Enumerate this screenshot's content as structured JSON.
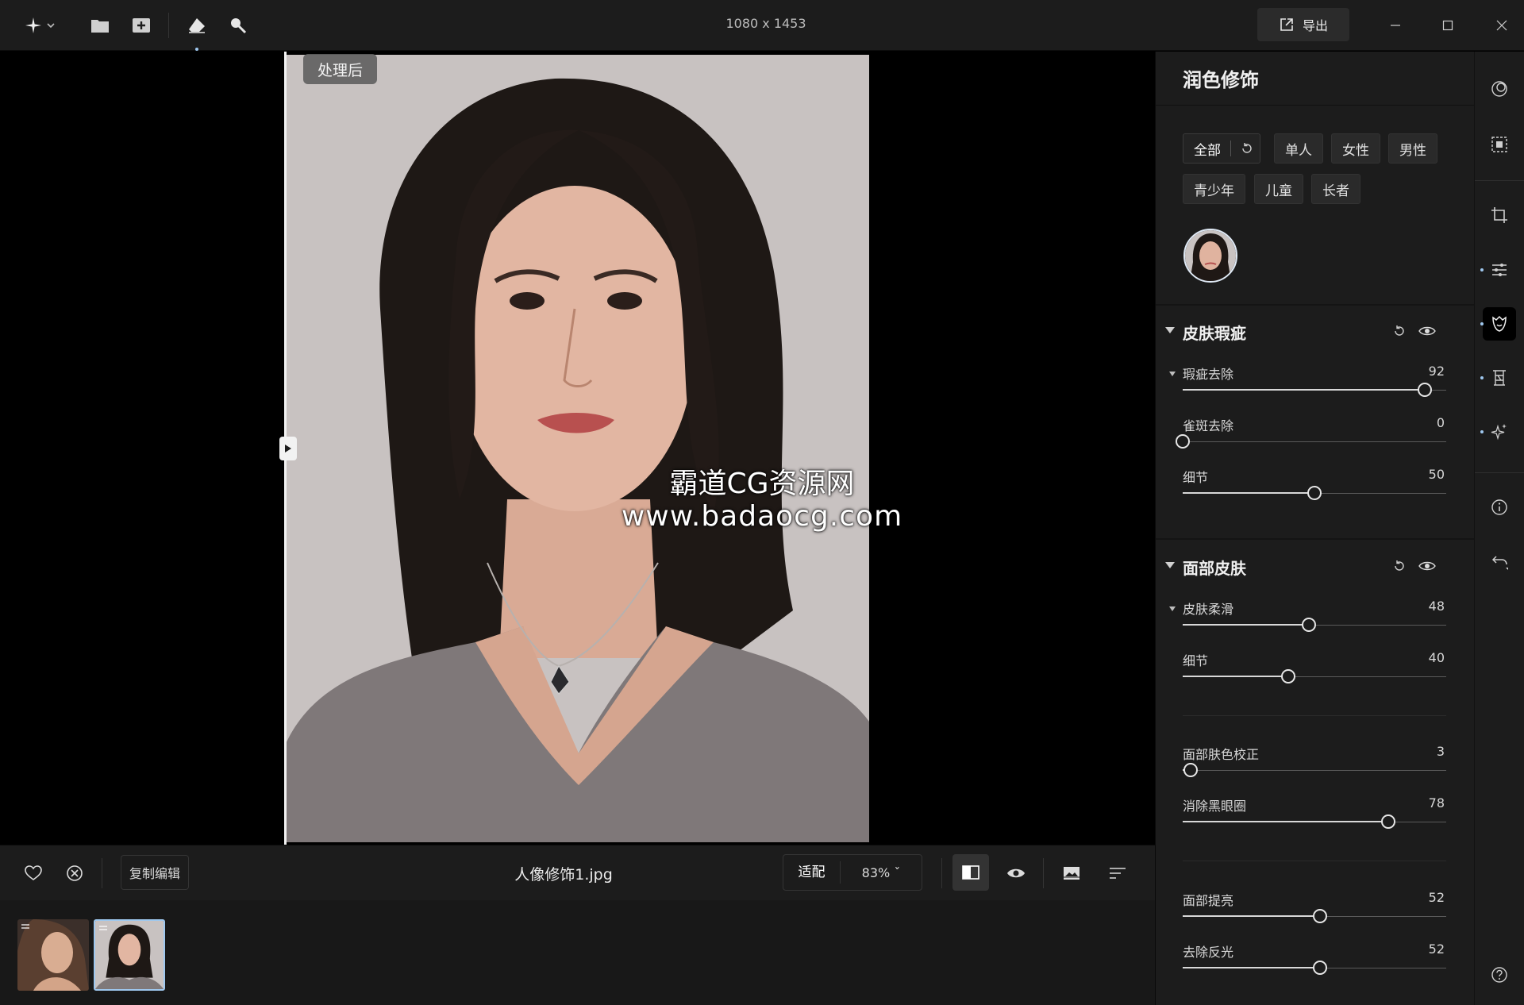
{
  "topbar": {
    "document_size": "1080 x 1453",
    "export_label": "导出"
  },
  "canvas": {
    "compare_badge": "处理后",
    "watermark_title": "霸道CG资源网",
    "watermark_url": "www.badaocg.com"
  },
  "bottombar": {
    "copy_edit_label": "复制编辑",
    "file_name": "人像修饰1.jpg",
    "fit_label": "适配",
    "zoom_label": "83% ˇ"
  },
  "panel": {
    "title": "润色修饰",
    "filter_chips": [
      "全部",
      "单人",
      "女性",
      "男性",
      "青少年",
      "儿童",
      "长者"
    ],
    "sections": [
      {
        "title": "皮肤瑕疵",
        "sliders": [
          {
            "label": "瑕疵去除",
            "value": 92,
            "min": 0,
            "max": 100
          },
          {
            "label": "雀斑去除",
            "value": 0,
            "min": 0,
            "max": 100
          },
          {
            "label": "细节",
            "value": 50,
            "min": 0,
            "max": 100
          }
        ]
      },
      {
        "title": "面部皮肤",
        "sliders": [
          {
            "label": "皮肤柔滑",
            "value": 48,
            "min": 0,
            "max": 100
          },
          {
            "label": "细节",
            "value": 40,
            "min": 0,
            "max": 100
          },
          {
            "label": "面部肤色校正",
            "value": 3,
            "min": 0,
            "max": 100
          },
          {
            "label": "消除黑眼圈",
            "value": 78,
            "min": 0,
            "max": 100
          },
          {
            "label": "面部提亮",
            "value": 52,
            "min": 0,
            "max": 100
          },
          {
            "label": "去除反光",
            "value": 52,
            "min": 0,
            "max": 100
          }
        ]
      }
    ]
  },
  "icons": {
    "logo": "sparkle-icon",
    "open": "folder-icon",
    "add": "add-image-icon",
    "erase": "eraser-icon",
    "search": "magnifier-icon",
    "export": "export-icon",
    "favorite": "heart-icon",
    "reject": "reject-icon",
    "rail": [
      "color-icon",
      "mask-icon",
      "crop-icon",
      "adjust-icon",
      "portrait-icon",
      "landscape-icon",
      "ai-icon",
      "info-icon",
      "undo-icon",
      "help-icon"
    ]
  },
  "colors": {
    "panel_bg": "#1c1c1c",
    "accent": "#9fc8ef",
    "text": "#e6e6e6"
  }
}
